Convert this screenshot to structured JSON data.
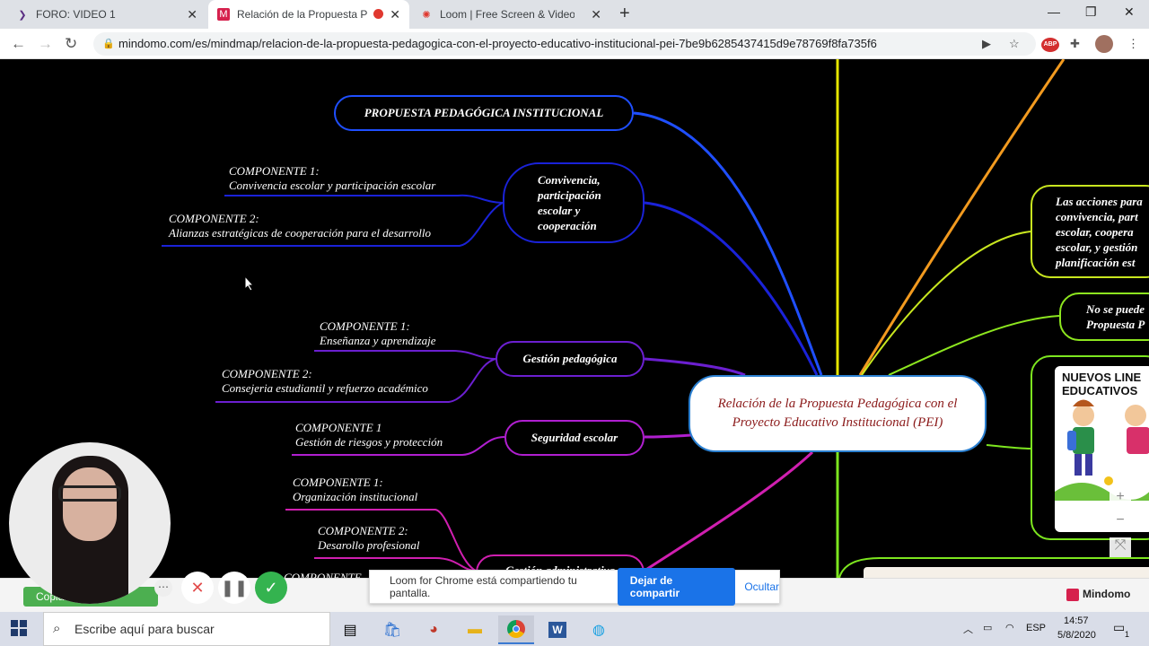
{
  "browser": {
    "tabs": [
      {
        "label": "FORO: VIDEO 1",
        "icon": "course-icon"
      },
      {
        "label": "Relación de la Propuesta Pedagógica",
        "icon": "mindomo-icon",
        "active": true
      },
      {
        "label": "Loom | Free Screen & Video Recording",
        "icon": "loom-icon"
      }
    ],
    "url": "mindomo.com/es/mindmap/relacion-de-la-propuesta-pedagogica-con-el-proyecto-educativo-institucional-pei-7be9b6285437415d9e78769f8fa735f6",
    "ext_badge": "ABP"
  },
  "mindmap": {
    "central": "Relación de la Propuesta Pedagógica con el Proyecto Educativo Institucional (PEI)",
    "branches": {
      "propuesta": "PROPUESTA PEDAGÓGICA INSTITUCIONAL",
      "convivencia": "Convivencia, participación escolar y cooperación",
      "gestion_pedagogica": "Gestión pedagógica",
      "seguridad": "Seguridad escolar",
      "gestion_admin": "Gestión administrativa"
    },
    "components": {
      "conv1_title": "COMPONENTE 1:",
      "conv1_text": "Convivencia escolar y participación escolar",
      "conv2_title": "COMPONENTE 2:",
      "conv2_text": "Alianzas estratégicas de cooperación para el desarrollo",
      "ped1_title": "COMPONENTE 1:",
      "ped1_text": "Enseñanza y aprendizaje",
      "ped2_title": "COMPONENTE 2:",
      "ped2_text": "Consejeria estudiantil y refuerzo académico",
      "seg1_title": "COMPONENTE 1",
      "seg1_text": "Gestión de riesgos y protección",
      "adm1_title": "COMPONENTE 1:",
      "adm1_text": "Organización institucional",
      "adm2_title": "COMPONENTE 2:",
      "adm2_text": "Desarollo profesional",
      "adm3_title": "COMPONENTE"
    },
    "right": {
      "acciones": [
        "Las acciones para",
        "convivencia, part",
        "escolar, coopera",
        "escolar, y gestión",
        "planificación est"
      ],
      "no_se": [
        "No se puede",
        "Propuesta P"
      ],
      "image_title": [
        "NUEVOS LINE",
        "EDUCATIVOS"
      ]
    },
    "zoom": {
      "in": "+",
      "out": "−",
      "fit": "⤧"
    },
    "copy_button": "Copiar mapa"
  },
  "share_banner": {
    "message": "Loom for Chrome está compartiendo tu pantalla.",
    "stop": "Dejar de compartir",
    "hide": "Ocultar"
  },
  "mindomo_brand": "Mindomo",
  "taskbar": {
    "search_placeholder": "Escribe aquí para buscar",
    "lang": "ESP",
    "time": "14:57",
    "date": "5/8/2020",
    "notifications": "1"
  },
  "colors": {
    "propuesta": "#1f4fff",
    "convivencia": "#1a22d8",
    "gestion_pedagogica": "#6b1fd0",
    "seguridad": "#b01fd0",
    "gestion_admin": "#d01fb0",
    "accent_yellow": "#e6e600",
    "accent_orange": "#f29a1f",
    "accent_green": "#7de61f",
    "share_blue": "#1a73e8"
  }
}
